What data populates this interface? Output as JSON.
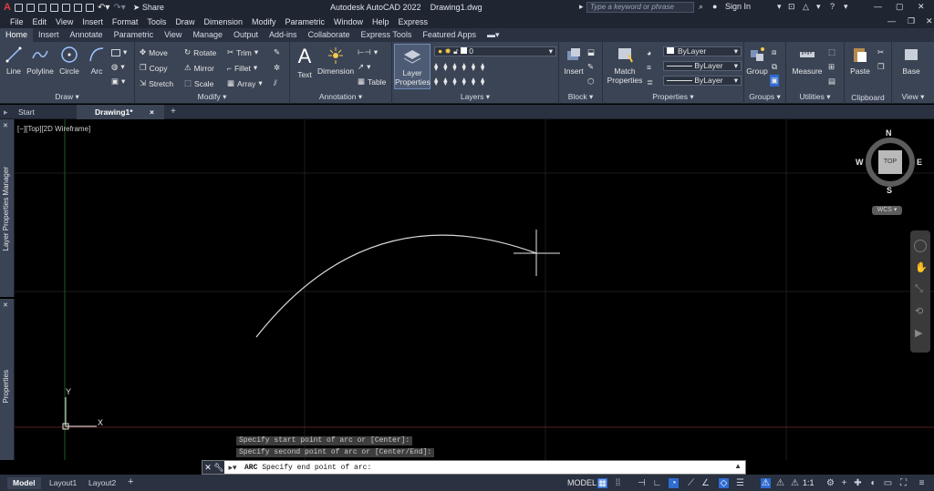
{
  "titlebar": {
    "app_title": "Autodesk AutoCAD 2022",
    "file_title": "Drawing1.dwg",
    "share_label": "Share",
    "search_placeholder": "Type a keyword or phrase",
    "sign_in": "Sign In",
    "app_logo": "A"
  },
  "menubar": {
    "items": [
      "File",
      "Edit",
      "View",
      "Insert",
      "Format",
      "Tools",
      "Draw",
      "Dimension",
      "Modify",
      "Parametric",
      "Window",
      "Help",
      "Express"
    ]
  },
  "ribbon_tabs": {
    "items": [
      "Home",
      "Insert",
      "Annotate",
      "Parametric",
      "View",
      "Manage",
      "Output",
      "Add-ins",
      "Collaborate",
      "Express Tools",
      "Featured Apps"
    ]
  },
  "ribbon": {
    "draw": {
      "title": "Draw",
      "line": "Line",
      "polyline": "Polyline",
      "circle": "Circle",
      "arc": "Arc"
    },
    "modify": {
      "title": "Modify",
      "move": "Move",
      "rotate": "Rotate",
      "trim": "Trim",
      "copy": "Copy",
      "mirror": "Mirror",
      "fillet": "Fillet",
      "stretch": "Stretch",
      "scale": "Scale",
      "array": "Array"
    },
    "annotation": {
      "title": "Annotation",
      "text": "Text",
      "dimension": "Dimension",
      "table": "Table"
    },
    "layers": {
      "title": "Layers",
      "layer_properties": "Layer Properties",
      "current_layer": "0"
    },
    "block": {
      "title": "Block",
      "insert": "Insert"
    },
    "properties": {
      "title": "Properties",
      "match": "Match Properties",
      "color": "ByLayer",
      "linetype": "ByLayer",
      "lineweight": "ByLayer"
    },
    "groups": {
      "title": "Groups",
      "group": "Group"
    },
    "utilities": {
      "title": "Utilities",
      "measure": "Measure"
    },
    "clipboard": {
      "title": "Clipboard",
      "paste": "Paste"
    },
    "view": {
      "title": "View",
      "base": "Base"
    }
  },
  "file_tabs": {
    "start": "Start",
    "drawing": "Drawing1*",
    "close": "×",
    "new": "+"
  },
  "palettes": {
    "layer_manager": "Layer Properties Manager",
    "properties": "Properties"
  },
  "viewport": {
    "label": "[−][Top][2D Wireframe]",
    "viewcube": {
      "top": "TOP",
      "n": "N",
      "s": "S",
      "e": "E",
      "w": "W",
      "wcs": "WCS"
    },
    "ucs": {
      "x": "X",
      "y": "Y"
    }
  },
  "command": {
    "history": [
      "Specify start point of arc or [Center]:",
      "Specify second point of arc or [Center/End]:"
    ],
    "prompt_cmd": "ARC",
    "prompt_text": "Specify end point of arc:"
  },
  "statusbar": {
    "tabs": [
      "Model",
      "Layout1",
      "Layout2"
    ],
    "model_label": "MODEL",
    "scale": "1:1"
  }
}
